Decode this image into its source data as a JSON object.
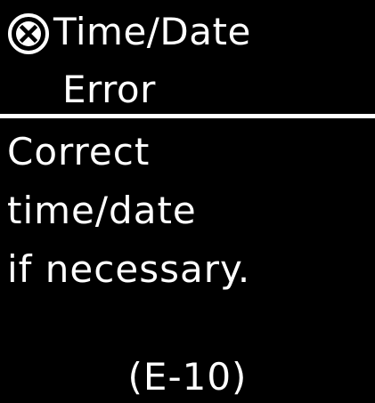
{
  "header": {
    "icon": "error-x-circle-icon",
    "title_line1": "Time/Date",
    "title_line2": "Error"
  },
  "message": {
    "lines": [
      "Correct",
      "time/date",
      "if necessary."
    ]
  },
  "error_code": "(E-10)",
  "colors": {
    "background": "#000000",
    "foreground": "#ffffff"
  }
}
